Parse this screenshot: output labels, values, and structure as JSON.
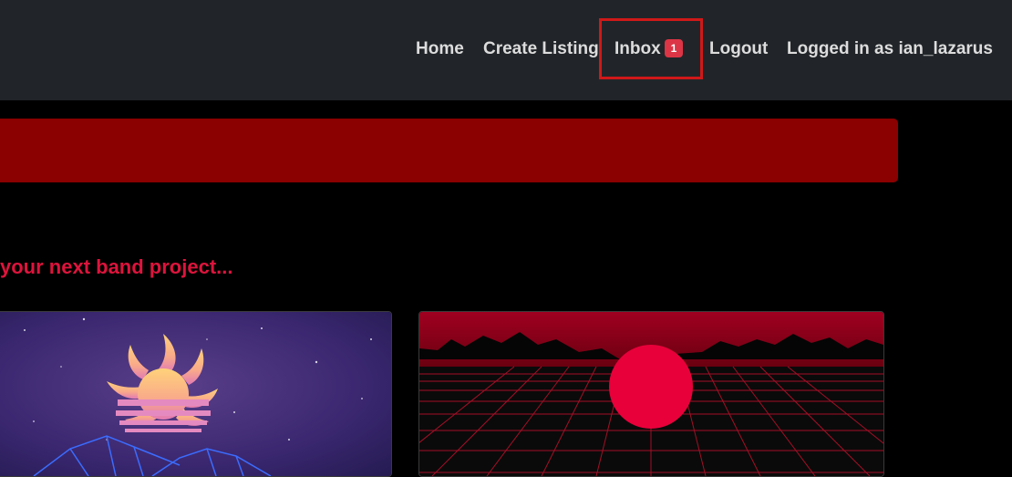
{
  "nav": {
    "home": "Home",
    "create_listing": "Create Listing",
    "inbox": "Inbox",
    "inbox_count": "1",
    "logout": "Logout",
    "logged_in": "Logged in as ian_lazarus"
  },
  "main": {
    "tagline": "your next band project..."
  },
  "colors": {
    "navbar": "#212529",
    "alert": "#8b0000",
    "accent": "#dc143c",
    "badge": "#dc3545"
  }
}
